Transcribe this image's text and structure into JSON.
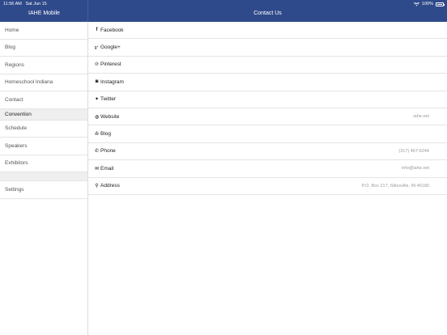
{
  "status_bar": {
    "time": "11:56 AM",
    "date": "Sat Jun 15",
    "battery": "100%"
  },
  "header": {
    "app_title": "IAHE Mobile",
    "page_title": "Contact Us"
  },
  "sidebar": {
    "items": [
      {
        "label": "Home"
      },
      {
        "label": "Blog"
      },
      {
        "label": "Regions"
      },
      {
        "label": "Homeschool Indiana"
      },
      {
        "label": "Contact"
      }
    ],
    "section_label": "Convention",
    "section_items": [
      {
        "label": "Schedule"
      },
      {
        "label": "Speakers"
      },
      {
        "label": "Exhibitors"
      }
    ],
    "settings_label": "Settings"
  },
  "contact": {
    "rows": [
      {
        "icon": "facebook-icon",
        "glyph": "f",
        "label": "Facebook",
        "value": ""
      },
      {
        "icon": "google-plus-icon",
        "glyph": "g⁺",
        "label": "Google+",
        "value": ""
      },
      {
        "icon": "pinterest-icon",
        "glyph": "℗",
        "label": "Pinterest",
        "value": ""
      },
      {
        "icon": "instagram-icon",
        "glyph": "◙",
        "label": "Instagram",
        "value": ""
      },
      {
        "icon": "twitter-icon",
        "glyph": "✦",
        "label": "Twitter",
        "value": ""
      },
      {
        "icon": "globe-icon",
        "glyph": "◍",
        "label": "Website",
        "value": "iahe.net"
      },
      {
        "icon": "blog-icon",
        "glyph": "✇",
        "label": "Blog",
        "value": ""
      },
      {
        "icon": "phone-icon",
        "glyph": "✆",
        "label": "Phone",
        "value": "(317) 467-6244"
      },
      {
        "icon": "envelope-icon",
        "glyph": "✉",
        "label": "Email",
        "value": "info@iahe.net"
      },
      {
        "icon": "map-pin-icon",
        "glyph": "⚲",
        "label": "Address",
        "value": "P.O. Box 217, Stilesville, IN 46180"
      }
    ]
  },
  "colors": {
    "header_bg": "#2f4a8a",
    "section_bg": "#efefef"
  }
}
